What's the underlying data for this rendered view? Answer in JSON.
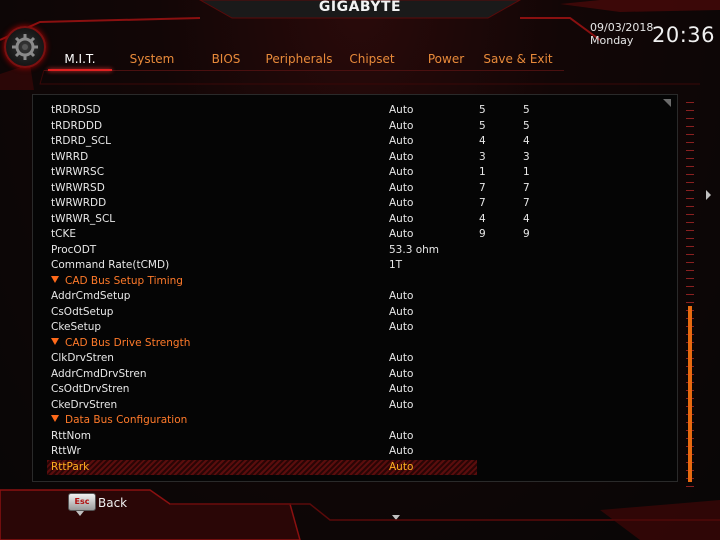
{
  "brand": "GIGABYTE",
  "datetime": {
    "date": "09/03/2018",
    "day": "Monday",
    "time": "20:36"
  },
  "tabs": [
    {
      "label": "M.I.T.",
      "active": true
    },
    {
      "label": "System"
    },
    {
      "label": "BIOS"
    },
    {
      "label": "Peripherals"
    },
    {
      "label": "Chipset"
    },
    {
      "label": "Power"
    },
    {
      "label": "Save & Exit"
    }
  ],
  "rows": [
    {
      "name": "tRDRDSD",
      "value": "Auto",
      "c1": "5",
      "c2": "5"
    },
    {
      "name": "tRDRDDD",
      "value": "Auto",
      "c1": "5",
      "c2": "5"
    },
    {
      "name": "tRDRD_SCL",
      "value": "Auto",
      "c1": "4",
      "c2": "4"
    },
    {
      "name": "tWRRD",
      "value": "Auto",
      "c1": "3",
      "c2": "3"
    },
    {
      "name": "tWRWRSC",
      "value": "Auto",
      "c1": "1",
      "c2": "1"
    },
    {
      "name": "tWRWRSD",
      "value": "Auto",
      "c1": "7",
      "c2": "7"
    },
    {
      "name": "tWRWRDD",
      "value": "Auto",
      "c1": "7",
      "c2": "7"
    },
    {
      "name": "tWRWR_SCL",
      "value": "Auto",
      "c1": "4",
      "c2": "4"
    },
    {
      "name": "tCKE",
      "value": "Auto",
      "c1": "9",
      "c2": "9"
    },
    {
      "name": "ProcODT",
      "value": "53.3 ohm",
      "c1": "",
      "c2": ""
    },
    {
      "name": "Command Rate(tCMD)",
      "value": "1T",
      "c1": "",
      "c2": ""
    },
    {
      "name": "CAD Bus Setup Timing",
      "section": true
    },
    {
      "name": "AddrCmdSetup",
      "value": "Auto",
      "c1": "",
      "c2": ""
    },
    {
      "name": "CsOdtSetup",
      "value": "Auto",
      "c1": "",
      "c2": ""
    },
    {
      "name": "CkeSetup",
      "value": "Auto",
      "c1": "",
      "c2": ""
    },
    {
      "name": "CAD Bus Drive Strength",
      "section": true
    },
    {
      "name": "ClkDrvStren",
      "value": "Auto",
      "c1": "",
      "c2": ""
    },
    {
      "name": "AddrCmdDrvStren",
      "value": "Auto",
      "c1": "",
      "c2": ""
    },
    {
      "name": "CsOdtDrvStren",
      "value": "Auto",
      "c1": "",
      "c2": ""
    },
    {
      "name": "CkeDrvStren",
      "value": "Auto",
      "c1": "",
      "c2": ""
    },
    {
      "name": "Data Bus Configuration",
      "section": true
    },
    {
      "name": "RttNom",
      "value": "Auto",
      "c1": "",
      "c2": ""
    },
    {
      "name": "RttWr",
      "value": "Auto",
      "c1": "",
      "c2": ""
    },
    {
      "name": "RttPark",
      "value": "Auto",
      "c1": "",
      "c2": "",
      "selected": true
    }
  ],
  "scroll": {
    "position": 0.52,
    "visible_fraction": 0.45
  },
  "footer": {
    "esc_label": "Esc",
    "back_label": "Back"
  },
  "colors": {
    "accent": "#e02020",
    "section": "#ff7a2a",
    "selected_text": "#ffb020",
    "tab_text": "#e88a3a"
  }
}
